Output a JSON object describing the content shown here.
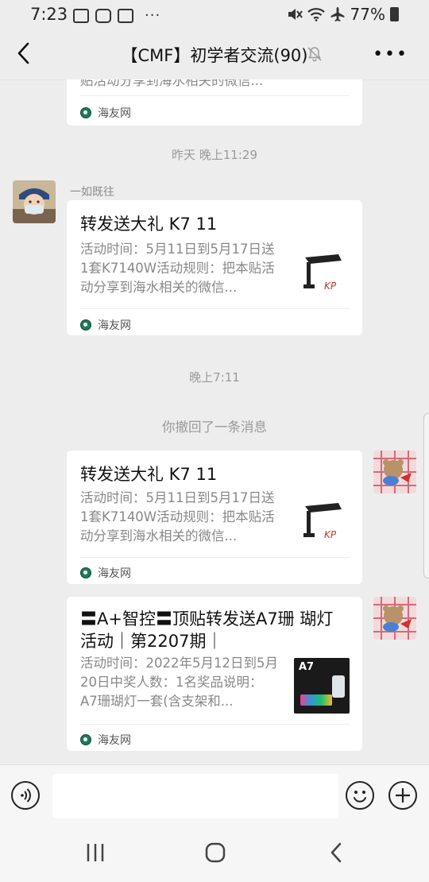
{
  "status_bar": {
    "time": "7:23",
    "battery": "77%"
  },
  "header": {
    "title": "【CMF】初学者交流(90)"
  },
  "messages": {
    "partial_card": {
      "desc_tail": "贴活动分享到海水相关的微信...",
      "source": "海友网"
    },
    "timestamp_1": "昨天 晚上11:29",
    "msg1": {
      "sender": "一如既往",
      "title": "转发送大礼 K7 11",
      "desc": "活动时间：5月11日到5月17日送1套K7140W活动规则：把本贴活动分享到海水相关的微信...",
      "source": "海友网"
    },
    "timestamp_2": "晚上7:11",
    "recall_note": "你撤回了一条消息",
    "msg2": {
      "title": "转发送大礼 K7 11",
      "desc": "活动时间：5月11日到5月17日送1套K7140W活动规则：把本贴活动分享到海水相关的微信...",
      "source": "海友网"
    },
    "msg3": {
      "title": "〓A+智控〓顶贴转发送A7珊 瑚灯活动｜第2207期｜",
      "desc": "活动时间：2022年5月12日到5月20日中奖人数：1名奖品说明：A7珊瑚灯一套(含支架和...",
      "thumb_label": "A7",
      "source": "海友网"
    }
  },
  "colors": {
    "background": "#ededed",
    "card": "#ffffff",
    "meta_text": "#9a9a9a"
  }
}
